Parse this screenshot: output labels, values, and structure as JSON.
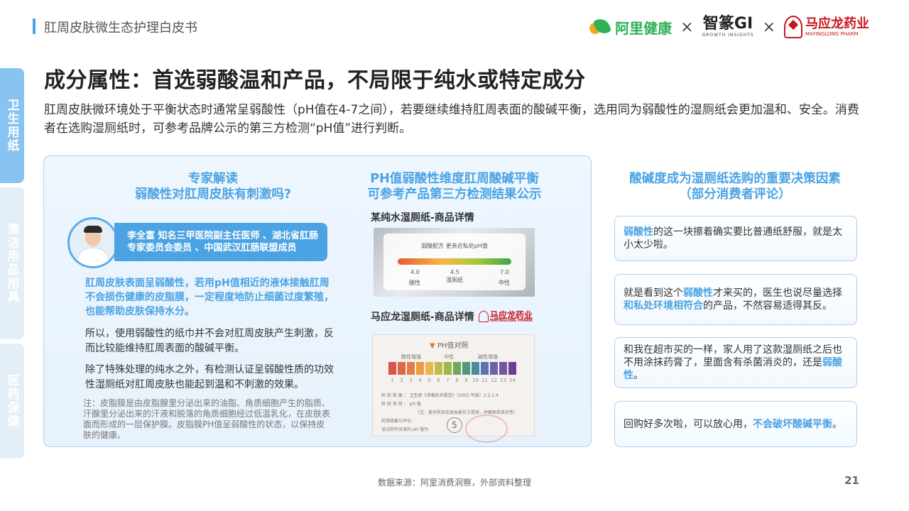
{
  "header": {
    "doc_title": "肛周皮肤微生态护理白皮书",
    "logo1": "阿里健康",
    "times": "×",
    "logo2_main": "智篆GI",
    "logo2_sub": "GROWTH INSIGHTS",
    "logo3_cn": "马应龙药业",
    "logo3_en": "MAYINGLONG PHARM"
  },
  "side_tabs": [
    "卫生用纸",
    "清洁用品用具",
    "医药保健"
  ],
  "main_title": "成分属性：首选弱酸温和产品，不局限于纯水或特定成分",
  "intro": "肛周皮肤微环境处于平衡状态时通常呈弱酸性（pH值在4-7之间），若要继续维持肛周表面的酸碱平衡，选用同为弱酸性的湿厕纸会更加温和、安全。消费者在选购湿厕纸时，可参考品牌公示的第三方检测“pH值”进行判断。",
  "expert": {
    "head_line1": "专家解读",
    "head_line2": "弱酸性对肛周皮肤有刺激吗?",
    "name_title": "李全富 知名三甲医院副主任医师 、湖北省肛肠专家委员会委员 、中国武汉肛肠联盟成员",
    "blue_para": "肛周皮肤表面呈弱酸性，若用pH值相近的液体接触肛周不会损伤健康的皮脂膜，一定程度地防止细菌过度繁殖，也能帮助皮肤保持水分。",
    "para1": "所以，使用弱酸性的纸巾并不会对肛周皮肤产生刺激，反而比较能维持肛周表面的酸碱平衡。",
    "para2": "除了特殊处理的纯水之外，有检测认证呈弱酸性质的功效性湿厕纸对肛周皮肤也能起到温和不刺激的效果。",
    "note": "注：皮脂膜是由皮脂腺里分泌出来的油脂、角质细胞产生的脂质、汗腺里分泌出来的汗液和脱落的角质细胞经过低温乳化，在皮肤表面而形成的一层保护膜。皮脂膜PH值呈弱酸性的状态，以保持皮肤的健康。"
  },
  "ph_section": {
    "head_line1": "PH值弱酸性维度肛周酸碱平衡",
    "head_line2": "可参考产品第三方检测结果公示",
    "product1_label": "某纯水湿厕纸-商品详情",
    "product1_card": "弱酸配方 更亲近私处pH值",
    "tick1_val": "4.0",
    "tick1_lbl": "酸性",
    "tick2_val": "4.5",
    "tick2_lbl": "湿厕纸",
    "tick3_val": "7.0",
    "tick3_lbl": "中性",
    "product2_label": "马应龙湿厕纸-商品详情",
    "product2_logo_cn": "马应龙药业",
    "product2_logo_en": "MAYINGLONG PHARM",
    "ph_chart_title": "PH值对照",
    "range_acid": "酸性增强",
    "range_neutral": "中性",
    "range_base": "碱性增强",
    "scale": [
      "1",
      "2",
      "3",
      "4",
      "5",
      "6",
      "7",
      "8",
      "9",
      "10",
      "11",
      "12",
      "13",
      "14"
    ],
    "scale_colors": [
      "#d9534f",
      "#e0664a",
      "#e67b46",
      "#ec9a4a",
      "#e9b64f",
      "#c9b94a",
      "#9cb84e",
      "#6ea85a",
      "#4f9a7a",
      "#4b8aa0",
      "#5b74b0",
      "#6b62ad",
      "#7a52a3",
      "#6b3f8f"
    ],
    "line1": "检 验 依 据 ： 卫生部《消毒技术规范》（2002 年版）2.2.1.4",
    "line2": "检 验 项 目 ： pH 值",
    "line3": "（注：委托样品信息由委托方提供，并确保其真实性）",
    "line4": "检测结果与评价：",
    "line5": "该试样所含液的 pH 值为",
    "result": "5"
  },
  "comments": {
    "head_line1": "酸碱度成为湿厕纸选购的重要决策因素",
    "head_line2": "（部分消费者评论）",
    "c1_hl": "弱酸性",
    "c1_rest": "的这一块擦着确实要比普通纸舒服，就是太小太少啦。",
    "c2_a": "就是看到这个",
    "c2_hl1": "弱酸性",
    "c2_b": "才来买的，医生也说尽量选择",
    "c2_hl2": "和私处环境相符合",
    "c2_c": "的产品，不然容易适得其反。",
    "c3_a": "和我在超市买的一样，家人用了这款湿厕纸之后也不用涂抹药膏了，里面含有杀菌消炎的，还是",
    "c3_hl": "弱酸性",
    "c3_b": "。",
    "c4_a": "回购好多次啦，可以放心用，",
    "c4_hl": "不会破坏酸碱平衡",
    "c4_b": "。"
  },
  "footer": {
    "source": "数据来源：阿里消费洞察，外部资料整理",
    "page": "21"
  },
  "colors": {
    "accent": "#4ba3e3",
    "brand_red": "#c8161d",
    "ali_green": "#2fb15a"
  }
}
